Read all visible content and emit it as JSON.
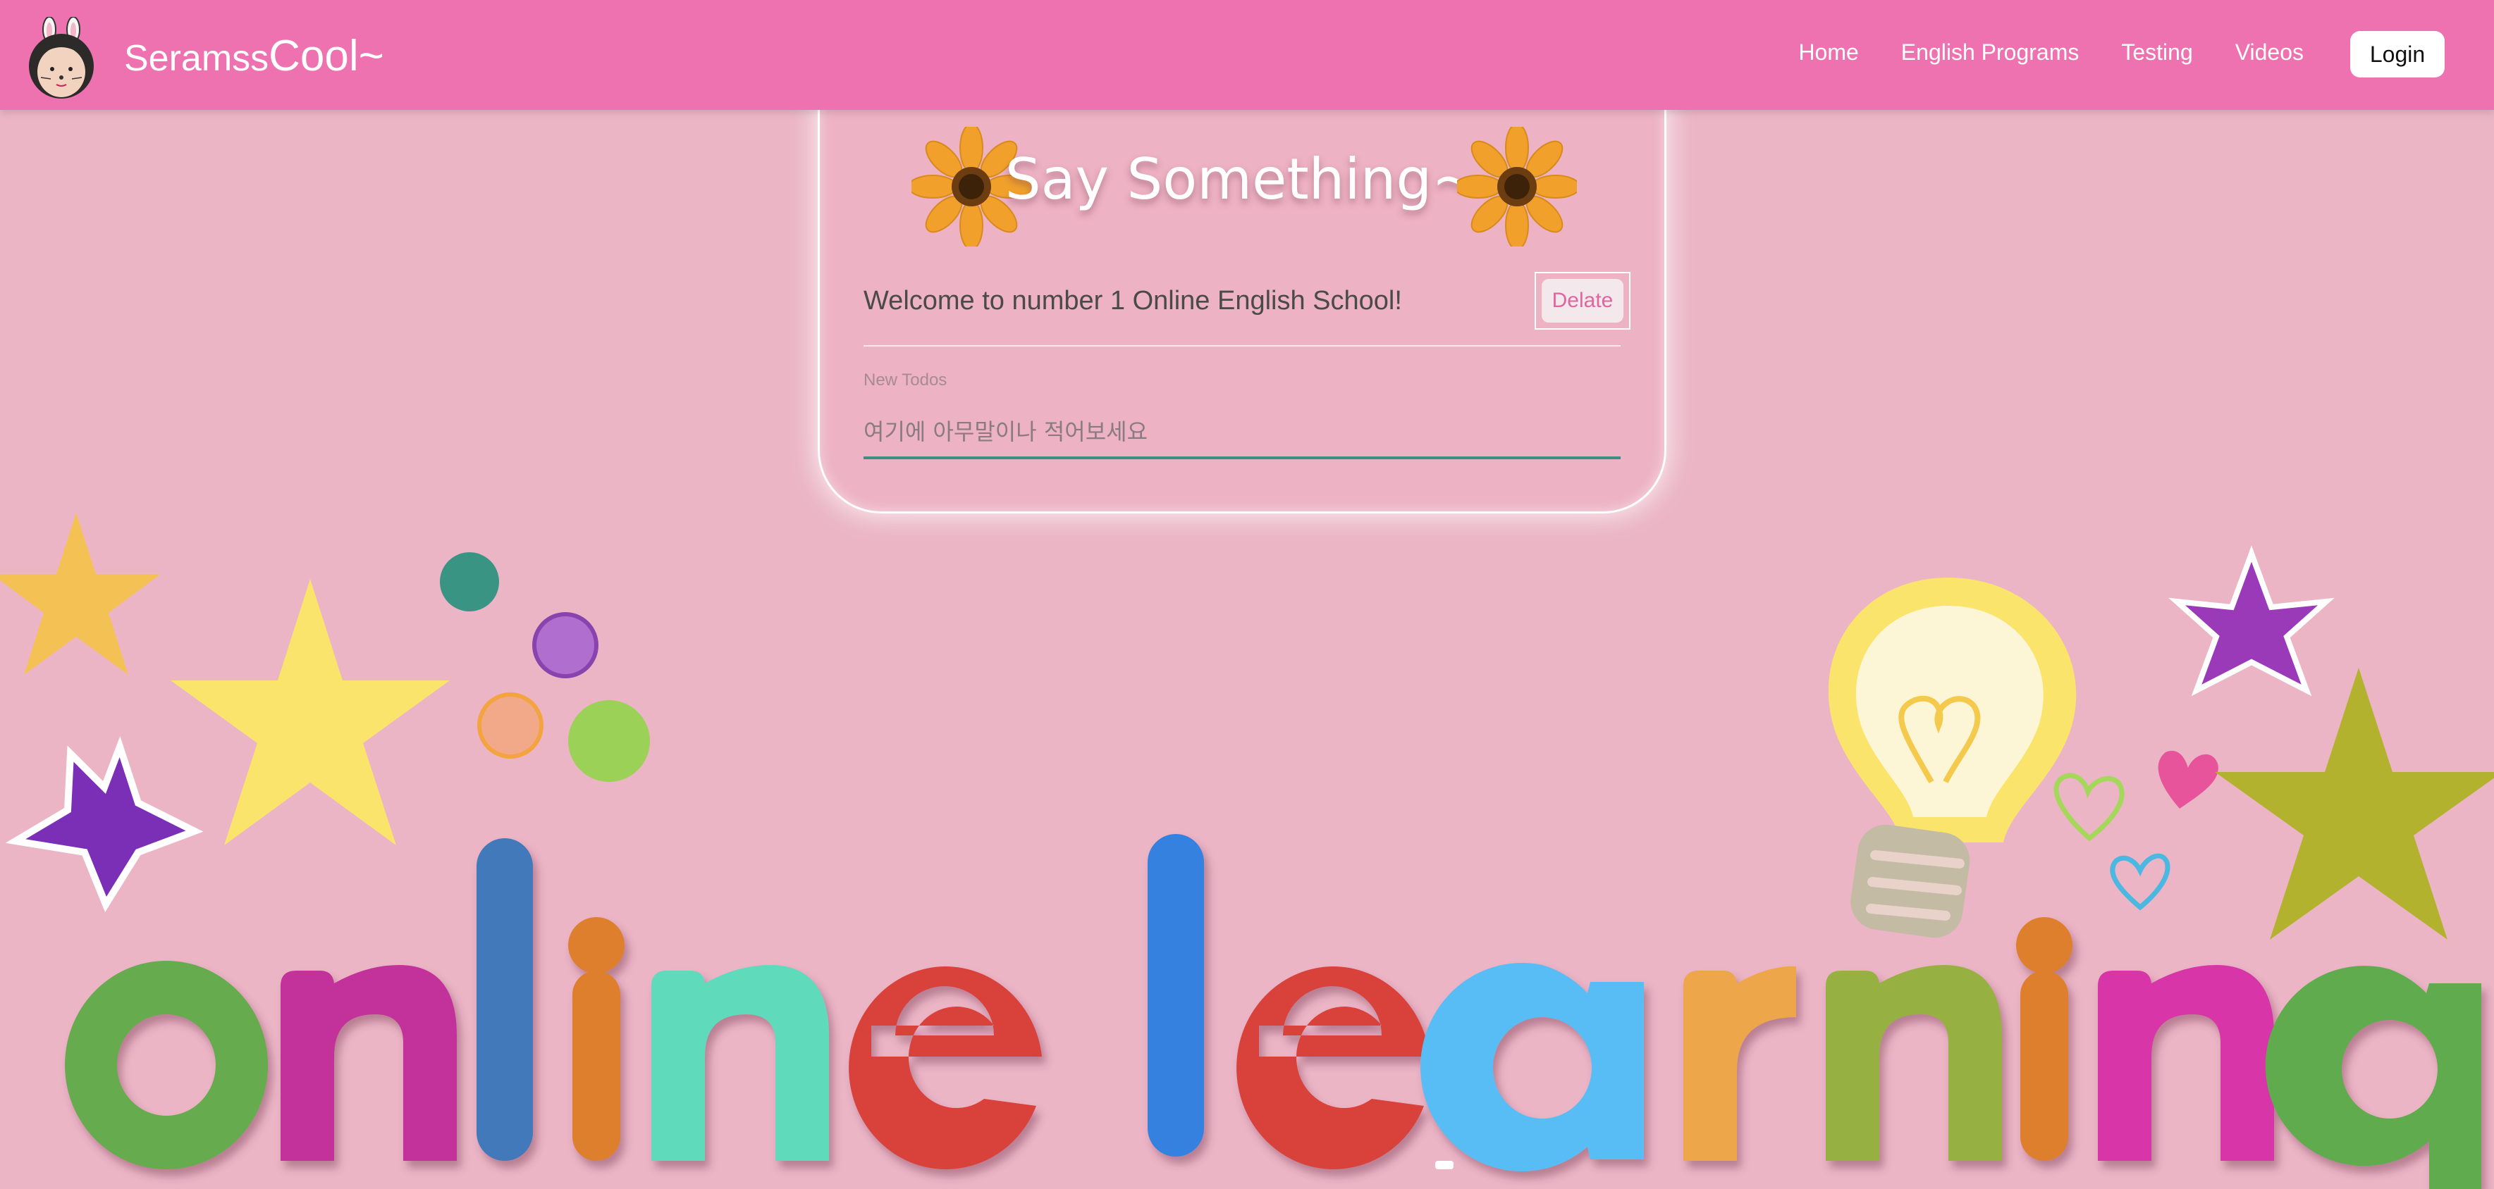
{
  "navbar": {
    "brand_prefix": "Seramss",
    "brand_suffix": "Cool~",
    "links": [
      "Home",
      "English Programs",
      "Testing",
      "Videos"
    ],
    "login_label": "Login"
  },
  "card": {
    "title": "Say Something~",
    "todos": [
      {
        "text": "Welcome to number 1 Online English School!",
        "delete_label": "Delate"
      }
    ],
    "new_label": "New Todos",
    "new_placeholder": "여기에 아무말이나 적어보세요"
  },
  "illustration": {
    "headline_letters": [
      "o",
      "n",
      "l",
      "i",
      "n",
      "e",
      "l",
      "e",
      "a",
      "r",
      "n",
      "i",
      "n",
      "g"
    ],
    "letter_colors": [
      "#66ab4d",
      "#c3339a",
      "#4279ba",
      "#de7f2f",
      "#5fdabb",
      "#d9423a",
      "#3681df",
      "#d9423a",
      "#58bdf5",
      "#eda649",
      "#97b042",
      "#de7f2f",
      "#d736a8",
      "#5fab4d"
    ]
  }
}
